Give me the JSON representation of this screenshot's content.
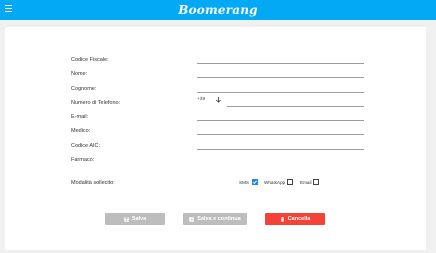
{
  "app": {
    "brand": "Boomerang",
    "menu_icon": "hamburger-menu-icon"
  },
  "form": {
    "fields": [
      {
        "key": "codice_fiscale",
        "label": "Codice Fiscale:",
        "value": ""
      },
      {
        "key": "nome",
        "label": "Nome:",
        "value": ""
      },
      {
        "key": "cognome",
        "label": "Cognome:",
        "value": ""
      },
      {
        "key": "telefono",
        "label": "Numero di Telefono:",
        "prefix": "+39",
        "value": ""
      },
      {
        "key": "email",
        "label": "E-mail:",
        "value": ""
      },
      {
        "key": "medico",
        "label": "Medico:",
        "value": ""
      },
      {
        "key": "aic",
        "label": "Codice AIC:",
        "value": ""
      },
      {
        "key": "farmaco",
        "label": "Farmaco:",
        "value": ""
      }
    ],
    "reminder": {
      "label": "Modalità sollecito:",
      "options": [
        {
          "label": "SMS",
          "checked": true
        },
        {
          "label": "WhatsApp",
          "checked": false
        },
        {
          "label": "Email",
          "checked": false
        }
      ]
    }
  },
  "actions": {
    "save_label": "Salva",
    "save_continue_label": "Salva e continua",
    "cancel_label": "Cancella"
  },
  "colors": {
    "header": "#03a9f4",
    "danger": "#f44336",
    "disabled": "#bdbdbd",
    "checkbox_checked": "#1e88e5"
  }
}
